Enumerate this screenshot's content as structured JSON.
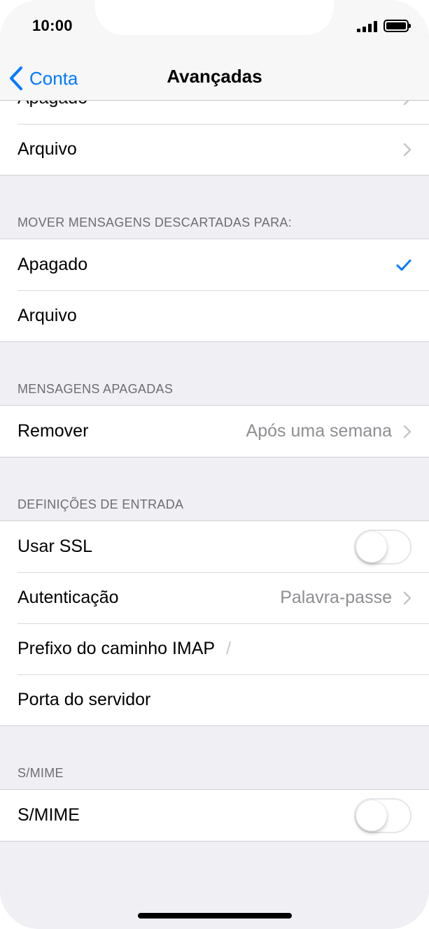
{
  "status": {
    "time": "10:00"
  },
  "nav": {
    "back_label": "Conta",
    "title": "Avançadas"
  },
  "top_group": {
    "items": [
      {
        "label": "Apagado"
      },
      {
        "label": "Arquivo"
      }
    ]
  },
  "move_discarded": {
    "header": "MOVER MENSAGENS DESCARTADAS PARA:",
    "items": [
      {
        "label": "Apagado",
        "selected": true
      },
      {
        "label": "Arquivo",
        "selected": false
      }
    ]
  },
  "deleted_messages": {
    "header": "MENSAGENS APAGADAS",
    "remove": {
      "label": "Remover",
      "value": "Após uma semana"
    }
  },
  "incoming_settings": {
    "header": "DEFINIÇÕES DE ENTRADA",
    "use_ssl": {
      "label": "Usar SSL",
      "on": false
    },
    "authentication": {
      "label": "Autenticação",
      "value": "Palavra-passe"
    },
    "imap_prefix": {
      "label": "Prefixo do caminho IMAP",
      "value": "/"
    },
    "server_port": {
      "label": "Porta do servidor"
    }
  },
  "smime": {
    "header": "S/MIME",
    "toggle": {
      "label": "S/MIME",
      "on": false
    }
  },
  "colors": {
    "accent": "#007aff",
    "background": "#efeff4",
    "secondary_text": "#8e8e93"
  },
  "icons": {
    "back": "chevron-left-icon",
    "disclosure": "chevron-right-icon",
    "selected": "checkmark-icon"
  }
}
